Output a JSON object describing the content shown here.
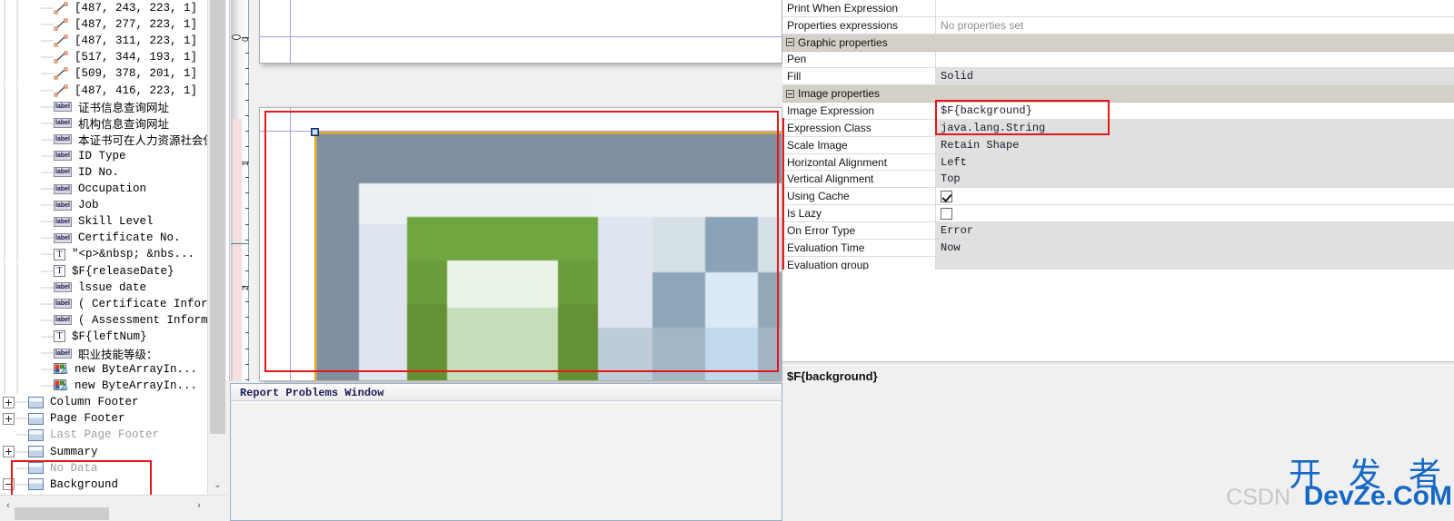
{
  "tree": {
    "rows": [
      {
        "icon": "line-element-icon",
        "label": "[487, 243, 223, 1]",
        "indent": 3,
        "expander": "none",
        "state": "normal"
      },
      {
        "icon": "line-element-icon",
        "label": "[487, 277, 223, 1]",
        "indent": 3,
        "expander": "none",
        "state": "normal"
      },
      {
        "icon": "line-element-icon",
        "label": "[487, 311, 223, 1]",
        "indent": 3,
        "expander": "none",
        "state": "normal"
      },
      {
        "icon": "line-element-icon",
        "label": "[517, 344, 193, 1]",
        "indent": 3,
        "expander": "none",
        "state": "normal"
      },
      {
        "icon": "line-element-icon",
        "label": "[509, 378, 201, 1]",
        "indent": 3,
        "expander": "none",
        "state": "normal"
      },
      {
        "icon": "line-element-icon",
        "label": "[487, 416, 223, 1]",
        "indent": 3,
        "expander": "none",
        "state": "normal"
      },
      {
        "icon": "static-text-label-icon",
        "label": "证书信息查询网址",
        "indent": 3,
        "expander": "none",
        "state": "normal"
      },
      {
        "icon": "static-text-label-icon",
        "label": "机构信息查询网址",
        "indent": 3,
        "expander": "none",
        "state": "normal"
      },
      {
        "icon": "static-text-label-icon",
        "label": "本证书可在人力资源社会保障部",
        "indent": 3,
        "expander": "none",
        "state": "normal"
      },
      {
        "icon": "static-text-label-icon",
        "label": "ID Type",
        "indent": 3,
        "expander": "none",
        "state": "normal"
      },
      {
        "icon": "static-text-label-icon",
        "label": "ID No.",
        "indent": 3,
        "expander": "none",
        "state": "normal"
      },
      {
        "icon": "static-text-label-icon",
        "label": "Occupation",
        "indent": 3,
        "expander": "none",
        "state": "normal"
      },
      {
        "icon": "static-text-label-icon",
        "label": "Job",
        "indent": 3,
        "expander": "none",
        "state": "normal"
      },
      {
        "icon": "static-text-label-icon",
        "label": "Skill Level",
        "indent": 3,
        "expander": "none",
        "state": "normal"
      },
      {
        "icon": "static-text-label-icon",
        "label": "Certificate No.",
        "indent": 3,
        "expander": "none",
        "state": "normal"
      },
      {
        "icon": "text-field-icon",
        "label": "\"<p>&nbsp; &nbs...",
        "indent": 3,
        "expander": "none",
        "state": "normal"
      },
      {
        "icon": "text-field-icon",
        "label": "$F{releaseDate}",
        "indent": 3,
        "expander": "none",
        "state": "normal"
      },
      {
        "icon": "static-text-label-icon",
        "label": "lssue date",
        "indent": 3,
        "expander": "none",
        "state": "normal"
      },
      {
        "icon": "static-text-label-icon",
        "label": "( Certificate Information ):",
        "indent": 3,
        "expander": "none",
        "state": "normal"
      },
      {
        "icon": "static-text-label-icon",
        "label": "( Assessment Information ): h",
        "indent": 3,
        "expander": "none",
        "state": "normal"
      },
      {
        "icon": "text-field-icon",
        "label": "$F{leftNum}",
        "indent": 3,
        "expander": "none",
        "state": "normal"
      },
      {
        "icon": "static-text-label-icon",
        "label": "职业技能等级：",
        "indent": 3,
        "expander": "none",
        "state": "normal"
      },
      {
        "icon": "image-element-icon",
        "label": "new ByteArrayIn...",
        "indent": 3,
        "expander": "none",
        "state": "normal"
      },
      {
        "icon": "image-element-icon",
        "label": "new ByteArrayIn...",
        "indent": 3,
        "expander": "none",
        "state": "normal"
      },
      {
        "icon": "band-icon",
        "label": "Column Footer",
        "indent": 1,
        "expander": "plus",
        "state": "normal"
      },
      {
        "icon": "band-icon",
        "label": "Page Footer",
        "indent": 1,
        "expander": "plus",
        "state": "normal"
      },
      {
        "icon": "band-icon",
        "label": "Last Page Footer",
        "indent": 1,
        "expander": "none",
        "state": "disabled"
      },
      {
        "icon": "band-icon",
        "label": "Summary",
        "indent": 1,
        "expander": "plus",
        "state": "normal"
      },
      {
        "icon": "band-icon",
        "label": "No Data",
        "indent": 1,
        "expander": "none",
        "state": "disabled"
      },
      {
        "icon": "band-icon",
        "label": "Background",
        "indent": 1,
        "expander": "minus",
        "state": "normal"
      },
      {
        "icon": "image-element-icon",
        "label": "$F{background}",
        "indent": 2,
        "expander": "none",
        "state": "selected"
      }
    ],
    "scroll_down_glyph": "⌄",
    "hscroll_left_glyph": "‹",
    "hscroll_right_glyph": "›"
  },
  "canvas": {
    "ruler_marks": [
      "0",
      "1",
      "2"
    ],
    "selected_element": "$F{background}"
  },
  "problems_window": {
    "tab_label": "Report Problems Window"
  },
  "properties": {
    "rows": [
      {
        "name": "Print When Expression",
        "value": "",
        "kind": "plain",
        "shaded": false
      },
      {
        "name": "Properties expressions",
        "value": "No properties set",
        "kind": "placeholder",
        "shaded": false
      },
      {
        "name": "Graphic properties",
        "value": "",
        "kind": "group",
        "shaded": false
      },
      {
        "name": "Pen",
        "value": "",
        "kind": "plain",
        "shaded": false
      },
      {
        "name": "Fill",
        "value": "Solid",
        "kind": "plain",
        "shaded": true
      },
      {
        "name": "Image properties",
        "value": "",
        "kind": "group",
        "shaded": false
      },
      {
        "name": "Image Expression",
        "value": "$F{background}",
        "kind": "plain",
        "shaded": false
      },
      {
        "name": "Expression Class",
        "value": "java.lang.String",
        "kind": "plain",
        "shaded": true
      },
      {
        "name": "Scale Image",
        "value": "Retain Shape",
        "kind": "plain",
        "shaded": true
      },
      {
        "name": "Horizontal Alignment",
        "value": "Left",
        "kind": "plain",
        "shaded": true
      },
      {
        "name": "Vertical Alignment",
        "value": "Top",
        "kind": "plain",
        "shaded": true
      },
      {
        "name": "Using Cache",
        "value": "",
        "kind": "checkbox-checked",
        "shaded": false
      },
      {
        "name": "Is Lazy",
        "value": "",
        "kind": "checkbox-unchecked",
        "shaded": false
      },
      {
        "name": "On Error Type",
        "value": "Error",
        "kind": "plain",
        "shaded": true
      },
      {
        "name": "Evaluation Time",
        "value": "Now",
        "kind": "plain",
        "shaded": true
      },
      {
        "name": "Evaluation group",
        "value": "",
        "kind": "plain",
        "shaded": true
      }
    ],
    "status_text": "$F{background}"
  },
  "watermark": {
    "chinese": "开 发 者",
    "english": "DevZe.CoM",
    "csdn": "CSDN"
  },
  "colors": {
    "annotation_red": "#e81717",
    "selection_orange": "#f2a900",
    "handle_blue": "#4a7ebb",
    "group_header": "#d4d0c8",
    "image_grey_blue": "#808f9f",
    "image_green": "#70a63f",
    "watermark_blue": "#1668c8"
  },
  "image_preview": {
    "description": "blurred report background preview",
    "palette": [
      "#808f9f",
      "#edf1f6",
      "#e3e8f0",
      "#70a63f",
      "#6b9c3a",
      "#639134",
      "#eaf3e8",
      "#c6dfba",
      "#d7e0ea",
      "#d5e0e6",
      "#8aa3b7",
      "#9eb2c3",
      "#bdccd8",
      "#c0d9ec",
      "#dbe9f5"
    ]
  }
}
